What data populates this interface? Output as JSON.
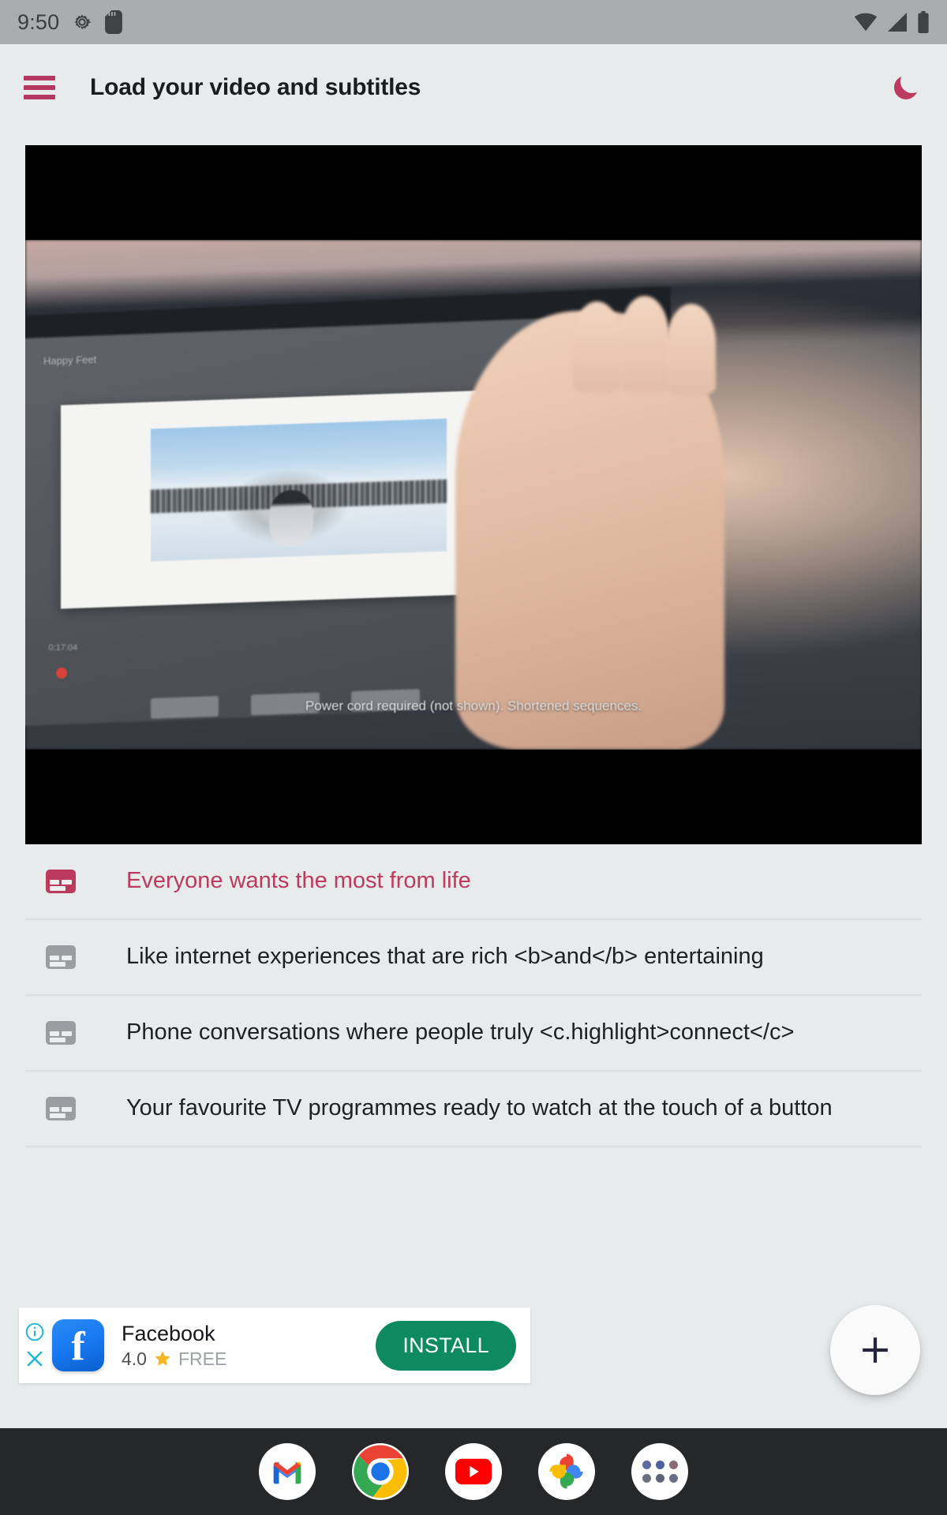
{
  "status_bar": {
    "time": "9:50",
    "icons_left": [
      "gear-icon",
      "sd-card-icon"
    ],
    "icons_right": [
      "wifi-icon",
      "signal-icon",
      "battery-icon"
    ],
    "background": "#a9adad"
  },
  "app_bar": {
    "menu_icon": "hamburger-menu-icon",
    "title": "Load your video and subtitles",
    "theme_toggle_icon": "moon-icon",
    "accent_color": "#b4385f"
  },
  "video": {
    "overlay_caption": "Power cord required (not shown). Shortened sequences.",
    "tablet_label": "Happy Feet",
    "timeline_time": "0:17:04",
    "letterbox_color": "#000000"
  },
  "subtitles": [
    {
      "icon": "subtitle-icon",
      "text": "Everyone wants the most from life",
      "active": true
    },
    {
      "icon": "subtitle-icon",
      "text": "Like internet experiences that are rich <b>and</b> entertaining",
      "active": false
    },
    {
      "icon": "subtitle-icon",
      "text": "Phone conversations where people truly <c.highlight>connect</c>",
      "active": false
    },
    {
      "icon": "subtitle-icon",
      "text": "Your favourite TV programmes ready to watch at the touch of a button",
      "active": false
    }
  ],
  "ad": {
    "info_icon": "info-icon",
    "close_icon": "close-icon",
    "app_icon": "facebook-icon",
    "app_name": "Facebook",
    "rating": "4.0",
    "star_icon": "star-icon",
    "price": "FREE",
    "cta_label": "INSTALL",
    "cta_color": "#0d8a5f",
    "icon_color": "#1778f2"
  },
  "fab": {
    "icon": "plus-icon",
    "color": "#fafafa"
  },
  "dock": {
    "background": "#262729",
    "apps": [
      {
        "name": "gmail-icon",
        "label": "Gmail"
      },
      {
        "name": "chrome-icon",
        "label": "Chrome"
      },
      {
        "name": "youtube-icon",
        "label": "YouTube"
      },
      {
        "name": "google-photos-icon",
        "label": "Photos"
      },
      {
        "name": "app-drawer-icon",
        "label": "Apps"
      }
    ]
  },
  "theme": {
    "page_background": "#e8ebec",
    "accent": "#bd3a5f",
    "text_primary": "#1f2022",
    "divider": "#dcdfe0"
  }
}
